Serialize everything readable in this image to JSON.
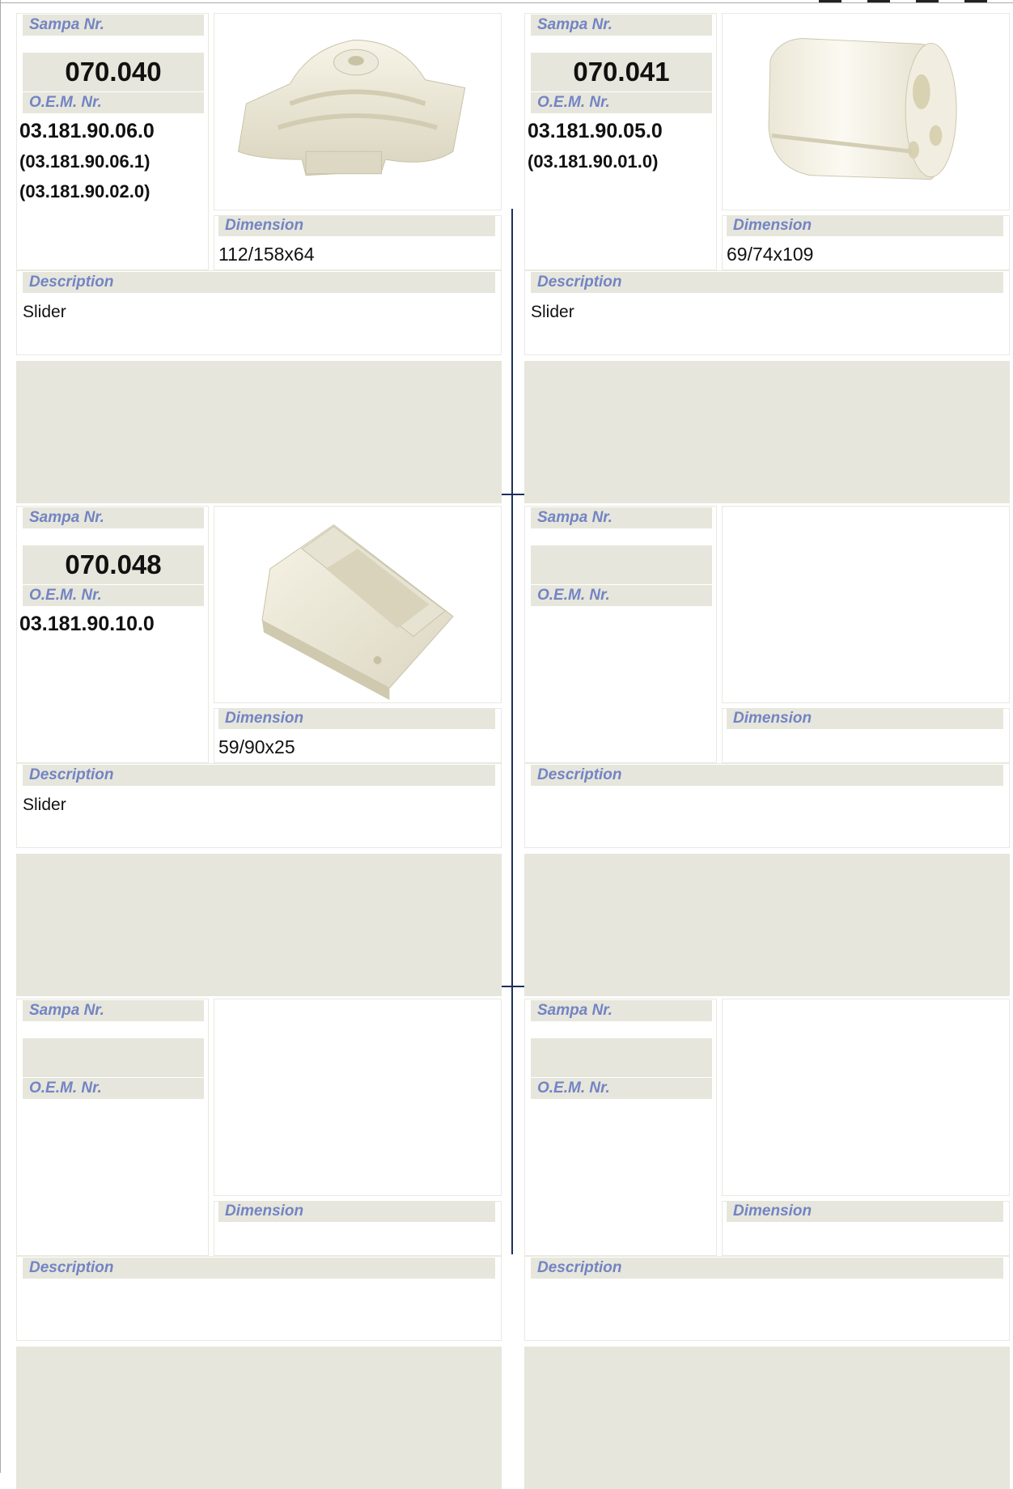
{
  "labels": {
    "sampa": "Sampa Nr.",
    "oem": "O.E.M. Nr.",
    "dimension": "Dimension",
    "description": "Description"
  },
  "items": [
    {
      "sampa": "070.040",
      "oem": [
        "03.181.90.06.0",
        "(03.181.90.06.1)",
        "(03.181.90.02.0)"
      ],
      "dimension": "112/158x64",
      "description": "Slider",
      "image": "slider-block-icon"
    },
    {
      "sampa": "070.041",
      "oem": [
        "03.181.90.05.0",
        "(03.181.90.01.0)"
      ],
      "dimension": "69/74x109",
      "description": "Slider",
      "image": "cylinder-slider-icon"
    },
    {
      "sampa": "070.048",
      "oem": [
        "03.181.90.10.0"
      ],
      "dimension": "59/90x25",
      "description": "Slider",
      "image": "grooved-block-icon"
    },
    {
      "sampa": "",
      "oem": [],
      "dimension": "",
      "description": "",
      "image": ""
    },
    {
      "sampa": "",
      "oem": [],
      "dimension": "",
      "description": "",
      "image": ""
    },
    {
      "sampa": "",
      "oem": [],
      "dimension": "",
      "description": "",
      "image": ""
    }
  ]
}
